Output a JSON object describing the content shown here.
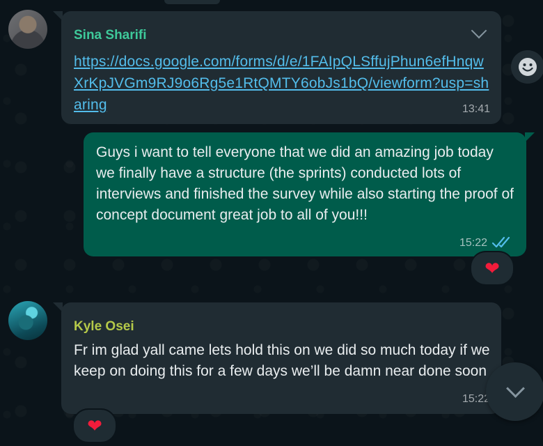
{
  "messages": [
    {
      "sender": "Sina Sharifi",
      "link": "https://docs.google.com/forms/d/e/1FAIpQLSffujPhun6efHnqwXrKpJVGm9RJ9o6Rg5e1RtQMTY6obJs1bQ/viewform?usp=sharing",
      "time": "13:41"
    },
    {
      "text": "Guys i want to tell everyone that we did an amazing job today we finally have a structure (the sprints) conducted lots of interviews and finished the survey while also starting the proof of concept document great job to all of you!!!",
      "time": "15:22",
      "reaction": "❤"
    },
    {
      "sender": "Kyle Osei",
      "text": "Fr im glad yall came lets hold this on we did so much today if we keep on doing this for a few days we’ll be damn near done soon",
      "time": "15:22",
      "reaction": "❤"
    }
  ],
  "icons": {
    "emoji": "emoji-icon",
    "menu": "chevron-down-icon",
    "scroll": "chevron-down-icon",
    "read": "double-check-icon"
  },
  "colors": {
    "background": "#0b141a",
    "incoming_bubble": "#202c33",
    "outgoing_bubble": "#005c4b",
    "link": "#53bdeb",
    "read_ticks": "#53bdeb"
  }
}
